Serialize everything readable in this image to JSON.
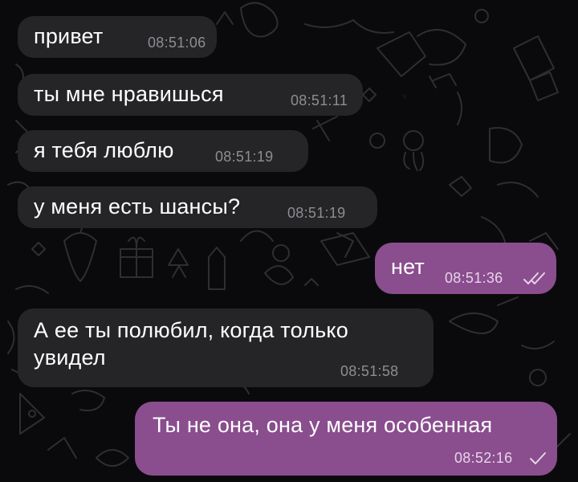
{
  "messages": [
    {
      "direction": "incoming",
      "text": "привет",
      "time": "08:51:06"
    },
    {
      "direction": "incoming",
      "text": "ты мне нравишься",
      "time": "08:51:11"
    },
    {
      "direction": "incoming",
      "text": "я тебя люблю",
      "time": "08:51:19"
    },
    {
      "direction": "incoming",
      "text": "у меня есть шансы?",
      "time": "08:51:19"
    },
    {
      "direction": "outgoing",
      "text": "нет",
      "time": "08:51:36",
      "status": "read-double-check-icon"
    },
    {
      "direction": "incoming",
      "text_line1": "А ее ты полюбил, когда только",
      "text_line2": "увидел",
      "time": "08:51:58"
    },
    {
      "direction": "outgoing",
      "text": "Ты не она, она у меня особенная",
      "time": "08:52:16",
      "status": "sent-single-check-icon"
    }
  ],
  "colors": {
    "background": "#0a0a0c",
    "incoming_bubble": "#252528",
    "outgoing_bubble": "#8a4d8e",
    "incoming_time": "#8d8d92",
    "outgoing_time": "#e7d4e8"
  }
}
